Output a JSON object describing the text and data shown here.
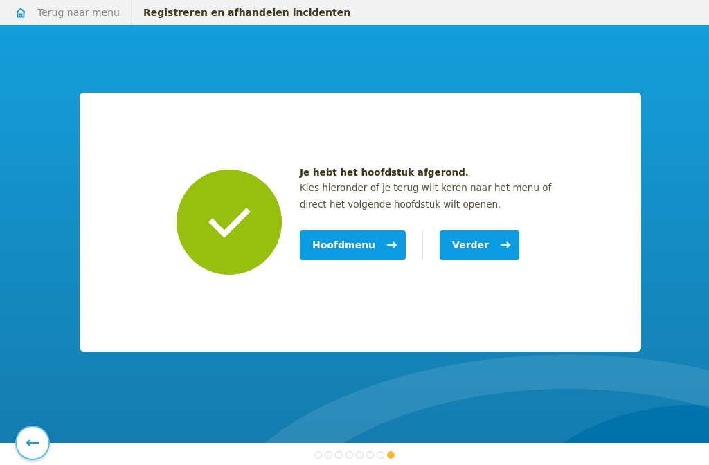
{
  "header": {
    "back_link": "Terug naar menu",
    "title": "Registreren en afhandelen incidenten"
  },
  "message": {
    "heading": "Je hebt het hoofdstuk afgerond.",
    "body": "Kies hieronder of je terug wilt keren naar het menu of direct het volgende hoofdstuk wilt openen."
  },
  "buttons": [
    {
      "label": "Hoofdmenu"
    },
    {
      "label": "Verder"
    }
  ],
  "pages": [
    {
      "selected": false
    },
    {
      "selected": false
    },
    {
      "selected": false
    },
    {
      "selected": false
    },
    {
      "selected": false
    },
    {
      "selected": false
    },
    {
      "selected": false
    },
    {
      "selected": true
    }
  ]
}
